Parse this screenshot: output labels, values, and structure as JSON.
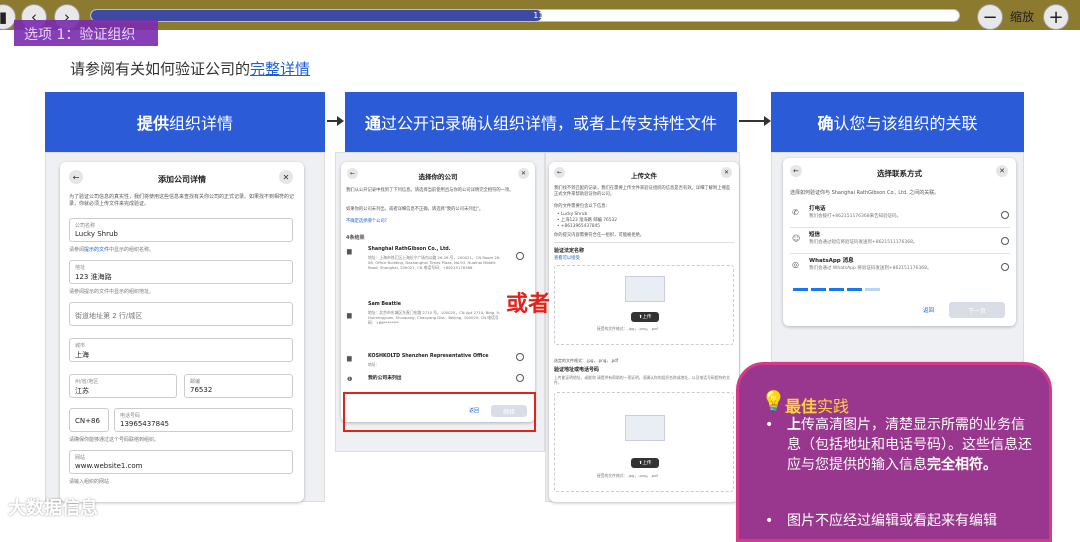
{
  "toolbar": {
    "back_icon": "chevron-left-icon",
    "forward_icon": "chevron-right-icon",
    "progress_label": "11 的 21",
    "progress_fraction": 0.52,
    "zoom_out": "−",
    "zoom_label": "缩放",
    "zoom_in": "+"
  },
  "slide": {
    "option_title": "选项 1：验证组织",
    "intro_text": "请参阅有关如何验证公司的",
    "intro_link": "完整详情",
    "step1_bold": "提供",
    "step1_rest": "组织详情",
    "step2_bold": "通",
    "step2_rest": "过公开记录确认组织详情，或者上传支持性文件",
    "step3_bold": "确",
    "step3_rest": "认您与该组织的关联",
    "or_label": "或者"
  },
  "card_add": {
    "title": "添加公司详情",
    "desc": "为了验证公司信息的真实性，我们将使用这些信息来查找有关你公司的正式记录。如果找不到相符的记录，你就必须上传文件来完成验证。",
    "company_label": "公司名称",
    "company_value": "Lucky Shrub",
    "hint1_pre": "请参阅",
    "hint1_link": "提示的文件",
    "hint1_post": "中显示的组织名称。",
    "address_label": "地址",
    "address_value": "123 淮海路",
    "hint2": "请参阅提示的文件中显示的组织地址。",
    "street2_placeholder": "街道地址第 2 行/城区",
    "city_label": "城市",
    "city_value": "上海",
    "province_label": "州/省/地区",
    "province_value": "江苏",
    "zip_label": "邮编",
    "zip_value": "76532",
    "country_code": "CN+86",
    "phone_label": "电话号码",
    "phone_value": "13965437845",
    "hint3": "请确保你能够通过这个号码联络到组织。",
    "website_label": "网站",
    "website_value": "www.website1.com",
    "hint4": "请输入组织的网站"
  },
  "card_choose": {
    "title": "选择你的公司",
    "desc": "我们从公开记录中找到了下列信息。请选择当前使用且与你的公司详情完全相符的一项。",
    "desc2": "如果你的公司未列出，或者详细信息不正确，请选择\"我的公司未列出\"。",
    "link": "不确定选择哪个公司?",
    "result_count": "4条结果",
    "results": [
      {
        "name": "Shanghai RathGibson Co., Ltd.",
        "detail": "地址：上海市徐汇区上海长宁广场内公路 26-28 号，200021，CN Room 26-08, Office Building, Dashanghai Times Plaza, No.93, Huaihai Middle Road, Shanghai, 200021, CN 电话号码：+86215176368"
      },
      {
        "name": "Sam Beattie",
        "detail": "地址：北京市东城区东直门东路 2710 号，100025，CN Apt 2710, Bldg. 9, Huimingyuan, Shuiqiang, Chaoyang Dist., Beijing, 100025, CN 电话号码：+86********"
      },
      {
        "name": "KOSHKOLTD Shenzhen Representative Office",
        "detail": "地址："
      },
      {
        "name": "我的公司未列出",
        "detail": ""
      }
    ],
    "back": "返回",
    "next": "继续"
  },
  "card_upload": {
    "title": "上传文件",
    "desc": "我们找不到匹配的记录，我们在需要上传文件来验证组织的信息是否有效。详细了解附上哪些正式文件来帮助验证你的公司。",
    "list_title": "你的文件需要包含以下信息：",
    "items": [
      "Lucky Shrub",
      "上海123 淮海路 邮编 76532",
      "+8613965437845"
    ],
    "note": "你的提交内容需要符合任一组织，可能被拒绝。",
    "section1": "验证法定名称",
    "section1_link": "查看可以接受",
    "upload_btn": "上传",
    "formats": "接受的文件格式：.jpg，.png，.pdf",
    "selected": "选定的文件格式：.jpg，.png，.pdf",
    "section2": "验证地址或电话号码",
    "section2_desc": "上传能证明地址，或能和 请提供有帮助的一项证明，须确认你的组织名称或地址，以及电话号码相符的文件。",
    "upload_btn2": "上传",
    "formats2": "接受的文件格式：.jpg，.png，.pdf"
  },
  "card_contact": {
    "title": "选择联系方式",
    "desc": "选择如何验证你与 Shanghai RathGibson Co., Ltd. 之间的关联。",
    "options": [
      {
        "icon": "phone-icon",
        "name": "打电话",
        "detail": "我们会拨打+862151176368来告知验证码。"
      },
      {
        "icon": "sms-icon",
        "name": "短信",
        "detail": "我们会通过短信将验证码发送到+8621511176368。"
      },
      {
        "icon": "whatsapp-icon",
        "name": "WhatsApp 消息",
        "detail": "我们会通过 WhatsApp 将验证码发送到+862151176368。"
      }
    ],
    "back": "返回",
    "next": "下一页"
  },
  "tip": {
    "icon": "lightbulb-icon",
    "title_bold": "最佳",
    "title_rest": "实践",
    "bullet1_bold": "上",
    "bullet1_rest": "传高清图片，清楚显示所需的业务信息（包括地址和电话号码）。这些信息还应与您提供的输入信息",
    "bullet1_end": "完全相符。",
    "bullet2": "图片不应经过编辑或看起来有编辑"
  },
  "watermark": "大数据信息",
  "colors": {
    "accent": "#2b5bd7",
    "tip_bg": "#99378e",
    "or_red": "#e0231d",
    "toolbar": "#8c7a2e"
  }
}
